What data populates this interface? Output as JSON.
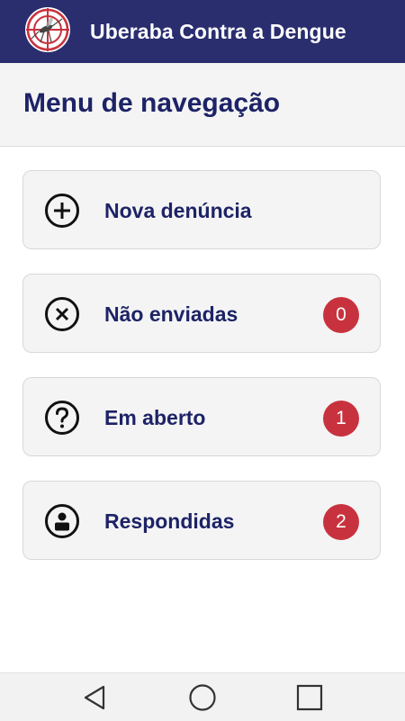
{
  "appbar": {
    "title": "Uberaba Contra a Dengue",
    "background": "#2a2e6f",
    "logo_icon": "mosquito-target-logo"
  },
  "page": {
    "title": "Menu de navegação"
  },
  "menu": {
    "items": [
      {
        "label": "Nova denúncia",
        "icon": "plus-circle-icon"
      },
      {
        "label": "Não enviadas",
        "icon": "close-circle-icon",
        "count": "0"
      },
      {
        "label": "Em aberto",
        "icon": "question-circle-icon",
        "count": "1"
      },
      {
        "label": "Respondidas",
        "icon": "user-circle-icon",
        "count": "2"
      }
    ],
    "badge_color": "#c8323e",
    "label_color": "#1d2366"
  },
  "navbar": {
    "buttons": [
      "back-icon",
      "home-icon",
      "recents-icon"
    ]
  }
}
